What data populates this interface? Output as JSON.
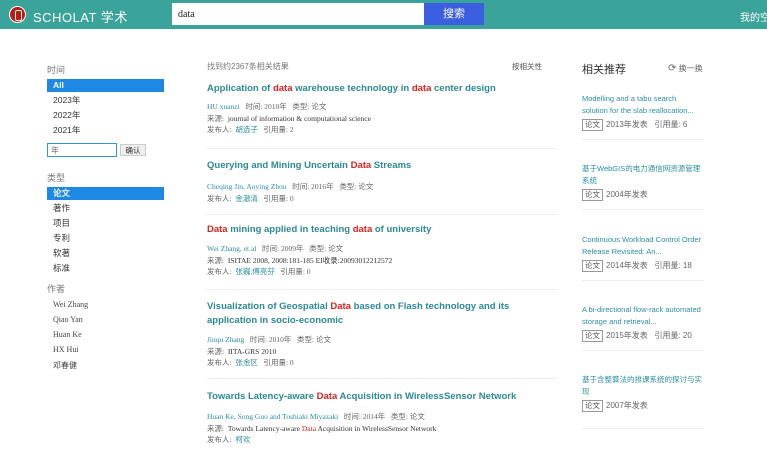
{
  "header": {
    "brand": "SCHOLAT 学术",
    "search_value": "data",
    "search_button": "搜索",
    "my_space": "我的空"
  },
  "filters": {
    "time_title": "时间",
    "time_items": [
      "All",
      "2023年",
      "2022年",
      "2021年"
    ],
    "year_placeholder": "年",
    "confirm": "确认",
    "type_title": "类型",
    "type_items": [
      "论文",
      "著作",
      "项目",
      "专利",
      "软著",
      "标准"
    ],
    "author_title": "作者",
    "authors": [
      "Wei Zhang",
      "Qiao Yan",
      "Huan Ke",
      "HX Hui",
      "邓春健"
    ]
  },
  "results_meta": {
    "count_text": "找到约2367条相关结果",
    "sort": "按相关性"
  },
  "results": [
    {
      "title_parts": [
        "Application of ",
        "data",
        " warehouse technology in ",
        "data",
        " center design"
      ],
      "authors": "HU xuanzi",
      "time": "时间: 2010年",
      "type": "类型: 论文",
      "source": "journal of information & computational science",
      "publisher": "胡选子",
      "cites": "引用量:   2"
    },
    {
      "title_parts": [
        "Querying and Mining Uncertain ",
        "Data",
        " Streams"
      ],
      "authors": "Cheqing Jin, Aoying Zhou",
      "time": "时间: 2016年",
      "type": "类型: 论文",
      "source": "",
      "publisher": "金澈清",
      "cites": "引用量:   0"
    },
    {
      "title_parts": [
        "",
        "Data",
        " mining applied in teaching ",
        "data",
        " of university"
      ],
      "authors": "Wei Zhang, et al",
      "time": "时间: 2009年",
      "type": "类型: 论文",
      "source": "ISITAE 2008, 2008:181-185 EI收录:20093012212572",
      "publisher": "张巍,傅亮芬",
      "cites": "引用量:   0"
    },
    {
      "title_parts": [
        "Visualization of Geospatial ",
        "Data",
        " based on Flash technology and its application in socio-economic"
      ],
      "authors": "Jinqu Zhang",
      "time": "时间: 2010年",
      "type": "类型: 论文",
      "source": "IITA-GRS 2010",
      "publisher": "张金区",
      "cites": "引用量:   0"
    },
    {
      "title_parts": [
        "Towards Latency-aware ",
        "Data",
        " Acquisition in WirelessSensor Network"
      ],
      "authors": "Huan Ke, Song Guo and Toshiaki Miyazaki",
      "time": "时间: 2014年",
      "type": "类型: 论文",
      "source_parts": [
        "Towards Latency-aware ",
        "Data",
        " Acquisition in WirelessSensor Network"
      ],
      "publisher": "柯欢",
      "cites": ""
    }
  ],
  "labels": {
    "source": "来源:",
    "publisher": "发布人:"
  },
  "sidebar": {
    "title": "相关推荐",
    "refresh": "换一换",
    "items": [
      {
        "name": "Modelling and a tabu search solution for the slab reallocation...",
        "tag": "论文",
        "year": "2013年发表",
        "cites": "引用量:   6"
      },
      {
        "name": "基于WebGIS的电力通信网资源管理系统",
        "tag": "论文",
        "year": "2004年发表",
        "cites": ""
      },
      {
        "name": "Continuous Workload Control Order Release Revisited: An...",
        "tag": "论文",
        "year": "2014年发表",
        "cites": "引用量:   18"
      },
      {
        "name": "A bi-directional flow-rack automated storage and retrieval...",
        "tag": "论文",
        "year": "2015年发表",
        "cites": "引用量:   20"
      },
      {
        "name": "基于含整算法的排课系统的探讨与实现",
        "tag": "论文",
        "year": "2007年发表",
        "cites": ""
      }
    ]
  }
}
